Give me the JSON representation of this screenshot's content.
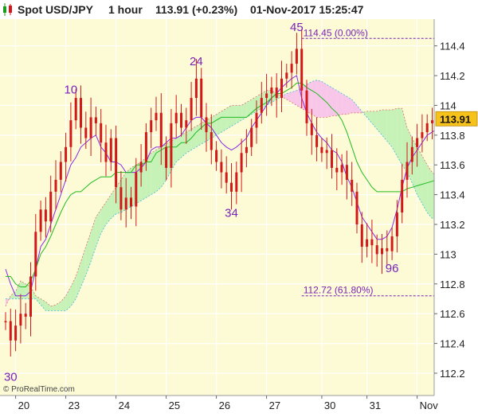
{
  "header": {
    "instrument": "Spot USD/JPY",
    "timeframe": "1 hour",
    "last_and_change": "113.91 (+0.23%)",
    "datetime": "01-Nov-2017 15:25:47"
  },
  "watermark": "© ProRealTime.com",
  "colors": {
    "background": "#fdfbd6",
    "candle": "#d21818",
    "tenkan": "#8a2be2",
    "kijun": "#22bb22",
    "cloud_bear": "#f7c6e8",
    "cloud_bull": "#c6f2b8",
    "label": "#7a22b8",
    "price_tag": "#f7c21a"
  },
  "chart_data": {
    "type": "candlestick",
    "title": "Spot USD/JPY",
    "timeframe": "1 hour",
    "last_price": 113.91,
    "change_pct": 0.23,
    "ylim": [
      112.05,
      114.58
    ],
    "y_ticks": [
      112.2,
      112.4,
      112.6,
      112.8,
      113,
      113.2,
      113.4,
      113.6,
      113.8,
      114,
      114.2,
      114.4
    ],
    "y_tick_labels": [
      "112.2",
      "112.4",
      "112.6",
      "112.8",
      "113",
      "113.2",
      "113.4",
      "113.6",
      "113.8",
      "114",
      "114.2",
      "114.4"
    ],
    "x_ticks": [
      {
        "label": "20",
        "i": 2
      },
      {
        "label": "23",
        "i": 12
      },
      {
        "label": "24",
        "i": 22
      },
      {
        "label": "25",
        "i": 32
      },
      {
        "label": "26",
        "i": 42
      },
      {
        "label": "27",
        "i": 52
      },
      {
        "label": "30",
        "i": 63
      },
      {
        "label": "31",
        "i": 72
      },
      {
        "label": "Nov",
        "i": 82
      }
    ],
    "swing_labels": [
      {
        "text": "30",
        "i": 1,
        "price": 112.15
      },
      {
        "text": "10",
        "i": 13,
        "price": 114.08
      },
      {
        "text": "24",
        "i": 38,
        "price": 114.27
      },
      {
        "text": "34",
        "i": 45,
        "price": 113.25
      },
      {
        "text": "45",
        "i": 58,
        "price": 114.5
      },
      {
        "text": "96",
        "i": 77,
        "price": 112.88
      }
    ],
    "levels": [
      {
        "label": "114.45 (0.00%)",
        "price": 114.45,
        "i_start": 59
      },
      {
        "label": "112.72 (61.80%)",
        "price": 112.72,
        "i_start": 59
      }
    ],
    "close": [
      112.55,
      112.42,
      112.52,
      112.6,
      112.58,
      112.85,
      113.15,
      113.3,
      113.22,
      113.42,
      113.5,
      113.62,
      113.72,
      113.9,
      114.05,
      113.85,
      113.78,
      113.92,
      113.88,
      113.75,
      113.62,
      113.78,
      113.45,
      113.3,
      113.38,
      113.32,
      113.55,
      113.62,
      113.82,
      113.9,
      113.95,
      113.72,
      113.58,
      113.88,
      113.95,
      113.85,
      113.9,
      114.05,
      114.18,
      113.92,
      113.82,
      113.7,
      113.62,
      113.55,
      113.48,
      113.42,
      113.55,
      113.68,
      113.72,
      113.85,
      113.95,
      114.05,
      114.08,
      114.12,
      114.05,
      114.18,
      114.22,
      114.28,
      114.38,
      114.1,
      113.88,
      113.8,
      113.72,
      113.68,
      113.7,
      113.58,
      113.55,
      113.6,
      113.5,
      113.42,
      113.2,
      113.05,
      113.1,
      113.06,
      113.0,
      113.04,
      113.02,
      113.12,
      113.28,
      113.5,
      113.62,
      113.72,
      113.78,
      113.82,
      113.88,
      113.9,
      113.91
    ],
    "tenkan": [
      112.9,
      112.8,
      112.72,
      112.72,
      112.72,
      112.75,
      112.9,
      113.05,
      113.1,
      113.2,
      113.3,
      113.4,
      113.5,
      113.6,
      113.65,
      113.72,
      113.75,
      113.78,
      113.8,
      113.72,
      113.68,
      113.62,
      113.62,
      113.6,
      113.55,
      113.55,
      113.55,
      113.58,
      113.62,
      113.7,
      113.72,
      113.72,
      113.75,
      113.78,
      113.78,
      113.8,
      113.85,
      113.9,
      113.92,
      113.92,
      113.88,
      113.85,
      113.8,
      113.75,
      113.72,
      113.7,
      113.72,
      113.75,
      113.78,
      113.85,
      113.9,
      113.95,
      114.0,
      114.05,
      114.08,
      114.12,
      114.15,
      114.18,
      114.2,
      114.05,
      113.95,
      113.88,
      113.82,
      113.78,
      113.75,
      113.7,
      113.68,
      113.62,
      113.52,
      113.45,
      113.35,
      113.25,
      113.2,
      113.15,
      113.1,
      113.1,
      113.12,
      113.18,
      113.3,
      113.45,
      113.58,
      113.65,
      113.7,
      113.75,
      113.8,
      113.82,
      113.85
    ],
    "kijun": [
      112.85,
      112.85,
      112.8,
      112.78,
      112.78,
      112.82,
      112.9,
      113.0,
      113.05,
      113.12,
      113.2,
      113.28,
      113.35,
      113.4,
      113.42,
      113.42,
      113.45,
      113.48,
      113.5,
      113.52,
      113.52,
      113.52,
      113.55,
      113.55,
      113.55,
      113.55,
      113.6,
      113.6,
      113.62,
      113.62,
      113.68,
      113.7,
      113.72,
      113.72,
      113.72,
      113.75,
      113.75,
      113.78,
      113.82,
      113.85,
      113.88,
      113.88,
      113.9,
      113.92,
      113.92,
      113.92,
      113.92,
      113.92,
      113.92,
      113.95,
      113.98,
      114.0,
      114.02,
      114.05,
      114.08,
      114.08,
      114.1,
      114.12,
      114.15,
      114.15,
      114.12,
      114.1,
      114.08,
      114.05,
      114.02,
      113.98,
      113.95,
      113.9,
      113.82,
      113.72,
      113.62,
      113.55,
      113.5,
      113.45,
      113.42,
      113.42,
      113.42,
      113.42,
      113.42,
      113.42,
      113.44,
      113.45,
      113.46,
      113.47,
      113.48,
      113.49,
      113.5
    ],
    "cloud": {
      "start_index": 0,
      "span_a": [
        112.65,
        112.72,
        112.75,
        112.82,
        112.8,
        112.78,
        112.72,
        112.7,
        112.68,
        112.65,
        112.66,
        112.68,
        112.72,
        112.78,
        112.85,
        112.95,
        113.05,
        113.15,
        113.25,
        113.3,
        113.35,
        113.4,
        113.45,
        113.5,
        113.55,
        113.58,
        113.6,
        113.62,
        113.65,
        113.68,
        113.7,
        113.72,
        113.74,
        113.76,
        113.78,
        113.8,
        113.82,
        113.84,
        113.86,
        113.88,
        113.9,
        113.92,
        113.94,
        113.96,
        113.98,
        114.0,
        114.0,
        114.0,
        114.02,
        114.04,
        114.06,
        114.08,
        114.1,
        114.1,
        114.08,
        114.06,
        114.04,
        114.02,
        114.0,
        113.98,
        113.96,
        113.94,
        113.92,
        113.92,
        113.92,
        113.93,
        113.93,
        113.94,
        113.94,
        113.95,
        113.95,
        113.95,
        113.96,
        113.96,
        113.96,
        113.97,
        113.97,
        113.97,
        113.98,
        113.98,
        113.85,
        113.78,
        113.72,
        113.66,
        113.6,
        113.55,
        113.52
      ],
      "span_b": [
        112.7,
        112.7,
        112.7,
        112.7,
        112.7,
        112.7,
        112.7,
        112.66,
        112.62,
        112.62,
        112.62,
        112.62,
        112.62,
        112.65,
        112.7,
        112.78,
        112.86,
        112.95,
        113.05,
        113.14,
        113.2,
        113.24,
        113.27,
        113.28,
        113.3,
        113.32,
        113.34,
        113.36,
        113.38,
        113.4,
        113.42,
        113.45,
        113.5,
        113.56,
        113.62,
        113.65,
        113.68,
        113.7,
        113.72,
        113.74,
        113.76,
        113.78,
        113.8,
        113.82,
        113.84,
        113.86,
        113.88,
        113.9,
        113.92,
        113.94,
        113.96,
        113.98,
        114.0,
        114.02,
        114.04,
        114.06,
        114.08,
        114.09,
        114.1,
        114.12,
        114.14,
        114.16,
        114.17,
        114.16,
        114.14,
        114.12,
        114.1,
        114.08,
        114.06,
        114.04,
        114.0,
        113.96,
        113.92,
        113.88,
        113.84,
        113.8,
        113.76,
        113.72,
        113.66,
        113.6,
        113.55,
        113.48,
        113.4,
        113.34,
        113.28,
        113.24,
        113.22
      ]
    }
  }
}
